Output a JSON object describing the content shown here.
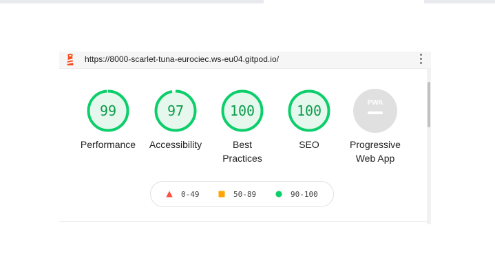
{
  "browser": {
    "url": "https://8000-scarlet-tuna-eurociec.ws-eu04.gitpod.io/"
  },
  "gauges": [
    {
      "score": "99",
      "label": "Performance",
      "value_fraction": 0.99
    },
    {
      "score": "97",
      "label": "Accessibility",
      "value_fraction": 0.97
    },
    {
      "score": "100",
      "label_line1": "Best",
      "label_line2": "Practices",
      "value_fraction": 1.0
    },
    {
      "score": "100",
      "label": "SEO",
      "value_fraction": 1.0
    },
    {
      "badge_text": "PWA",
      "label_line1": "Progressive",
      "label_line2": "Web App"
    }
  ],
  "legend": {
    "fail": "0-49",
    "average": "50-89",
    "pass": "90-100"
  },
  "colors": {
    "pass": "#0cce6b",
    "pass_text": "#0c9b4b",
    "pass_fill": "#e6f8ee",
    "average": "#ffa400",
    "fail": "#ff4e42",
    "pwa_gray": "#e0e0e0"
  },
  "icons": [
    "lighthouse-icon",
    "more-vert-icon",
    "pwa-badge-icon"
  ]
}
